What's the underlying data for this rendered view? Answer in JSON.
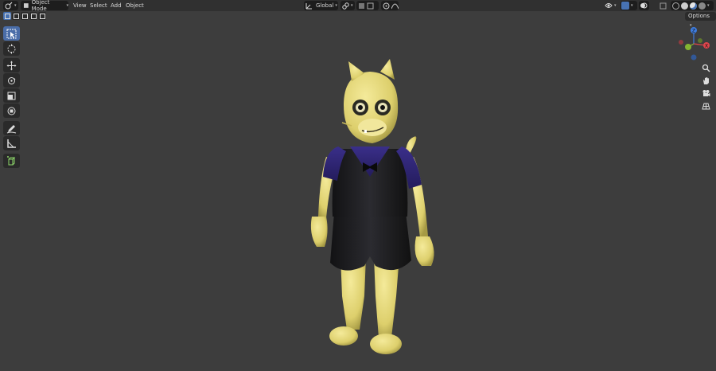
{
  "header": {
    "mode_label": "Object Mode",
    "menus": [
      "View",
      "Select",
      "Add",
      "Object"
    ],
    "transform_orientation": "Global",
    "options_label": "Options"
  },
  "gizmo": {
    "axes": [
      "X",
      "Y",
      "Z"
    ],
    "colors": {
      "x": "#e0454c",
      "y": "#84b532",
      "z": "#3e7de0"
    }
  },
  "toolbar": {
    "tools": [
      "select-box",
      "cursor",
      "move",
      "rotate",
      "scale",
      "transform",
      "annotate",
      "measure",
      "add-cube"
    ],
    "active": "select-box"
  },
  "colors": {
    "accent": "#4772b3",
    "viewport_bg": "#3d3d3d",
    "header_bg": "#303030"
  }
}
